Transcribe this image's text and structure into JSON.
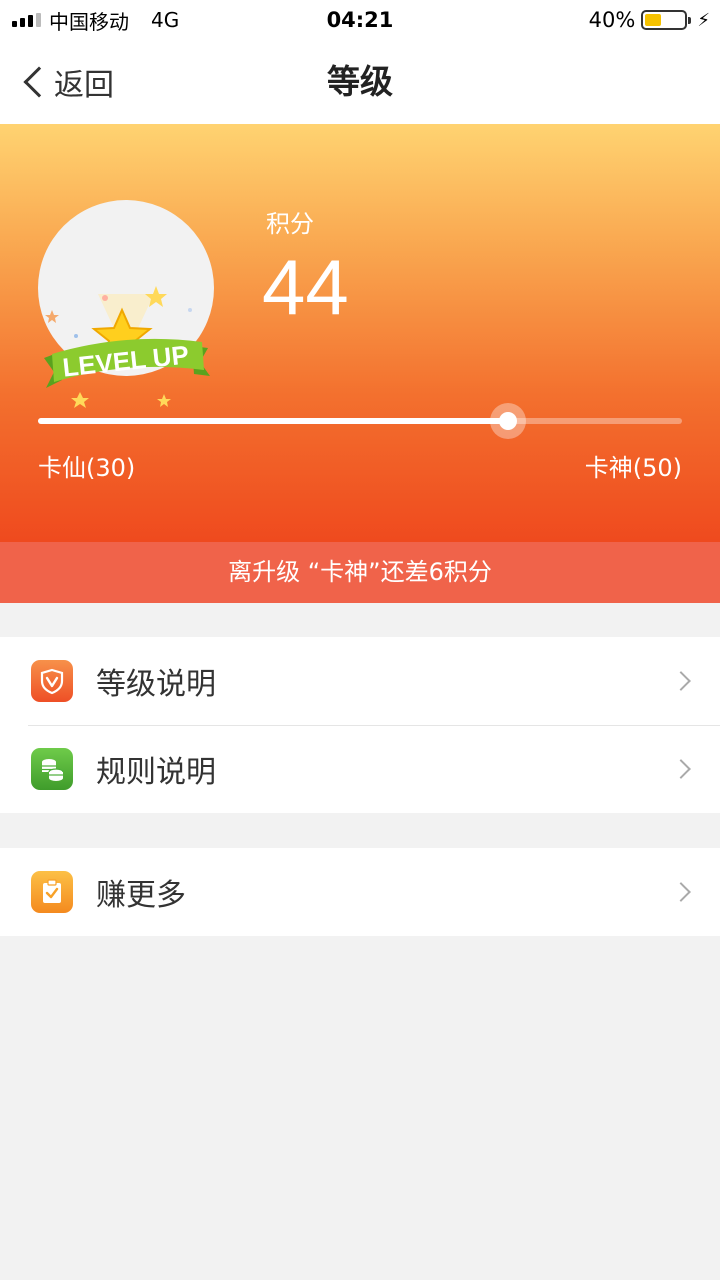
{
  "status_bar": {
    "carrier": "中国移动",
    "network": "4G",
    "time": "04:21",
    "battery_percent": "40%",
    "battery_level": 0.4,
    "battery_color": "#f6c200"
  },
  "nav": {
    "back_label": "返回",
    "title": "等级"
  },
  "hero": {
    "badge_text": "LEVEL UP",
    "points_label": "积分",
    "points_value": "44",
    "progress_fraction": 0.73,
    "current_level": "卡仙(30)",
    "next_level": "卡神(50)",
    "upgrade_hint": "离升级 “卡神”还差6积分"
  },
  "menu_group1": {
    "items": [
      {
        "label": "等级说明",
        "icon": "shield-v-icon",
        "icon_color": "#f06a32"
      },
      {
        "label": "规则说明",
        "icon": "coins-icon",
        "icon_color": "#4cae3a"
      }
    ]
  },
  "menu_group2": {
    "items": [
      {
        "label": "赚更多",
        "icon": "clipboard-check-icon",
        "icon_color": "#f7a128"
      }
    ]
  }
}
